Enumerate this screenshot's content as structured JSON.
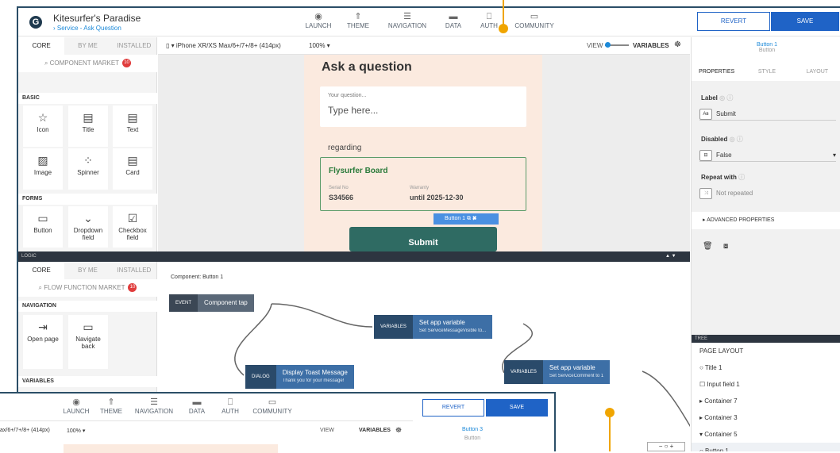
{
  "app": {
    "title": "Kitesurfer's Paradise",
    "subtitle": "› Service - Ask Question",
    "logo": "G"
  },
  "nav": [
    {
      "label": "LAUNCH",
      "icon": "◉"
    },
    {
      "label": "THEME",
      "icon": "⇑"
    },
    {
      "label": "NAVIGATION",
      "icon": "☰"
    },
    {
      "label": "DATA",
      "icon": "▬"
    },
    {
      "label": "AUTH",
      "icon": "⎕"
    },
    {
      "label": "COMMUNITY",
      "icon": "▭"
    }
  ],
  "actions": {
    "revert": "REVERT",
    "save": "SAVE"
  },
  "left": {
    "tabs": [
      "CORE",
      "BY ME",
      "INSTALLED"
    ],
    "search": "COMPONENT MARKET",
    "badge": "10",
    "sections": {
      "basic": "BASIC",
      "forms": "FORMS"
    },
    "tiles": [
      {
        "label": "Icon",
        "icon": "☆"
      },
      {
        "label": "Title",
        "icon": "▤"
      },
      {
        "label": "Text",
        "icon": "▤"
      },
      {
        "label": "Image",
        "icon": "▨"
      },
      {
        "label": "Spinner",
        "icon": "⁘"
      },
      {
        "label": "Card",
        "icon": "▤"
      },
      {
        "label": "Button",
        "icon": "▭"
      },
      {
        "label": "Dropdown field",
        "icon": "⌄"
      },
      {
        "label": "Checkbox field",
        "icon": "☑"
      }
    ]
  },
  "canvas": {
    "device": "iPhone XR/XS Max/6+/7+/8+ (414px)",
    "zoom": "100% ▾",
    "view": "VIEW",
    "variables": "VARIABLES"
  },
  "phone": {
    "title": "Ask a question",
    "q_label": "Your question...",
    "q_placeholder": "Type here...",
    "regarding": "regarding",
    "card_title": "Flysurfer Board",
    "serial_label": "Serial No",
    "serial": "S34566",
    "warranty_label": "Warranty",
    "warranty": "until 2025-12-30",
    "selected": "Button 1",
    "submit": "Submit"
  },
  "props": {
    "name": "Button 1",
    "type": "Button",
    "tabs": [
      "PROPERTIES",
      "STYLE",
      "LAYOUT"
    ],
    "label_h": "Label",
    "label_v": "Submit",
    "disabled_h": "Disabled",
    "disabled_v": "False",
    "repeat_h": "Repeat with",
    "repeat_v": "Not repeated",
    "advanced": "ADVANCED PROPERTIES"
  },
  "logic": {
    "bar": "LOGIC",
    "tabs": [
      "CORE",
      "BY ME",
      "INSTALLED"
    ],
    "search": "FLOW FUNCTION MARKET",
    "badge": "10",
    "nav_h": "NAVIGATION",
    "vars_h": "VARIABLES",
    "tiles": [
      {
        "label": "Open page",
        "icon": "⇥"
      },
      {
        "label": "Navigate back",
        "icon": "▭"
      }
    ],
    "component": "Component: Button 1",
    "nodes": [
      {
        "tag": "EVENT",
        "title": "Component tap",
        "sub": ""
      },
      {
        "tag": "VARIABLES",
        "title": "Set app variable",
        "sub": "Set ServiceMessageVisible to..."
      },
      {
        "tag": "DIALOG",
        "title": "Display Toast Message",
        "sub": "Thank you for your message!"
      },
      {
        "tag": "VARIABLES",
        "title": "Set app variable",
        "sub": "Set ServiceComment to 1"
      }
    ]
  },
  "tree": {
    "header": "TREE",
    "items": [
      "PAGE LAYOUT",
      "○ Title 1",
      "☐ Input field 1",
      "▸ Container 7",
      "▸ Container 3",
      "▾ Container 5",
      "○ Button 1"
    ]
  },
  "overlay": {
    "device": "ax/6+/7+/8+ (414px)",
    "zoom": "100% ▾",
    "button": "Button 3",
    "type": "Button"
  }
}
